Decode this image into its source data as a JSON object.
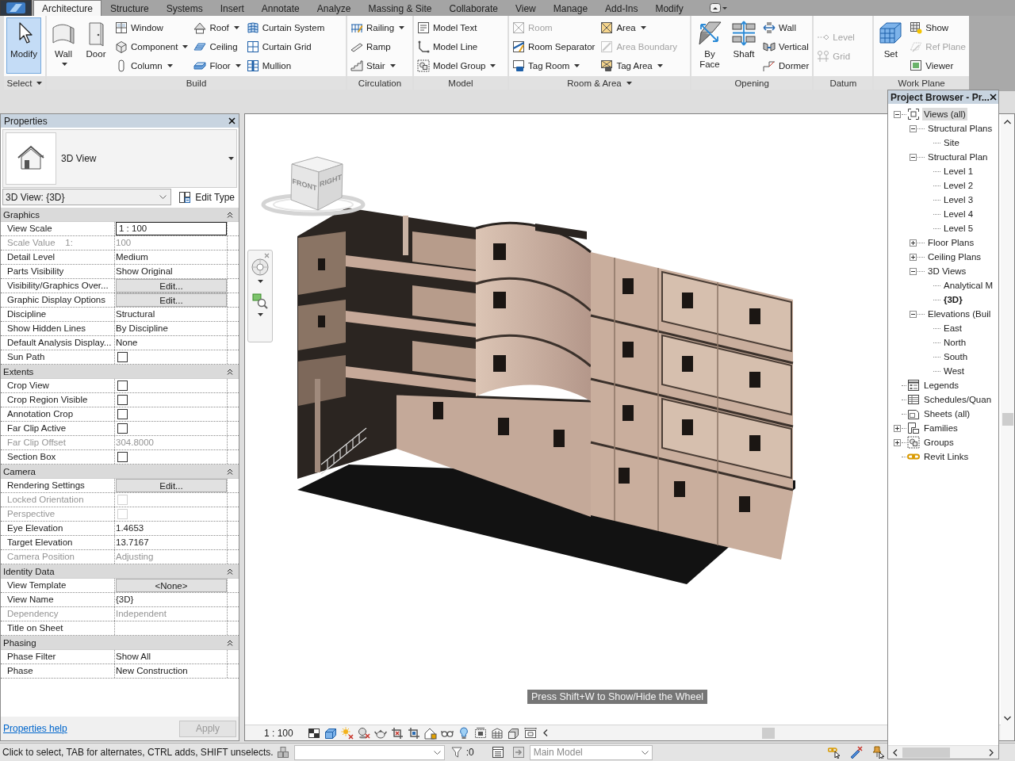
{
  "ribbon": {
    "tabs": [
      {
        "label": "Architecture",
        "selected": true
      },
      {
        "label": "Structure",
        "selected": false
      },
      {
        "label": "Systems",
        "selected": false
      },
      {
        "label": "Insert",
        "selected": false
      },
      {
        "label": "Annotate",
        "selected": false
      },
      {
        "label": "Analyze",
        "selected": false
      },
      {
        "label": "Massing & Site",
        "selected": false
      },
      {
        "label": "Collaborate",
        "selected": false
      },
      {
        "label": "View",
        "selected": false
      },
      {
        "label": "Manage",
        "selected": false
      },
      {
        "label": "Add-Ins",
        "selected": false
      },
      {
        "label": "Modify",
        "selected": false
      }
    ],
    "panels": [
      {
        "title": "Select",
        "title_dropdown": true,
        "columns": [
          {
            "kind": "large",
            "label": "Modify",
            "dropdown": false,
            "active": true
          }
        ]
      },
      {
        "title": "Build",
        "title_dropdown": false,
        "columns": [
          {
            "kind": "large",
            "label": "Wall",
            "dropdown": true,
            "active": false
          },
          {
            "kind": "large",
            "label": "Door",
            "dropdown": false,
            "active": false
          },
          {
            "kind": "stack",
            "items": [
              {
                "label": "Window",
                "dropdown": false,
                "disabled": false
              },
              {
                "label": "Component",
                "dropdown": true,
                "disabled": false
              },
              {
                "label": "Column",
                "dropdown": true,
                "disabled": false
              }
            ]
          },
          {
            "kind": "stack",
            "items": [
              {
                "label": "Roof",
                "dropdown": true,
                "disabled": false
              },
              {
                "label": "Ceiling",
                "dropdown": false,
                "disabled": false
              },
              {
                "label": "Floor",
                "dropdown": true,
                "disabled": false
              }
            ]
          },
          {
            "kind": "stack",
            "items": [
              {
                "label": "Curtain System",
                "dropdown": false,
                "disabled": false
              },
              {
                "label": "Curtain Grid",
                "dropdown": false,
                "disabled": false
              },
              {
                "label": "Mullion",
                "dropdown": false,
                "disabled": false
              }
            ]
          }
        ]
      },
      {
        "title": "Circulation",
        "title_dropdown": false,
        "columns": [
          {
            "kind": "stack",
            "items": [
              {
                "label": "Railing",
                "dropdown": true,
                "disabled": false
              },
              {
                "label": "Ramp",
                "dropdown": false,
                "disabled": false
              },
              {
                "label": "Stair",
                "dropdown": true,
                "disabled": false
              }
            ]
          }
        ]
      },
      {
        "title": "Model",
        "title_dropdown": false,
        "columns": [
          {
            "kind": "stack",
            "items": [
              {
                "label": "Model Text",
                "dropdown": false,
                "disabled": false
              },
              {
                "label": "Model Line",
                "dropdown": false,
                "disabled": false
              },
              {
                "label": "Model Group",
                "dropdown": true,
                "disabled": false
              }
            ]
          }
        ]
      },
      {
        "title": "Room & Area",
        "title_dropdown": true,
        "columns": [
          {
            "kind": "stack",
            "items": [
              {
                "label": "Room",
                "dropdown": false,
                "disabled": true
              },
              {
                "label": "Room Separator",
                "dropdown": false,
                "disabled": false
              },
              {
                "label": "Tag Room",
                "dropdown": true,
                "disabled": false
              }
            ]
          },
          {
            "kind": "stack",
            "items": [
              {
                "label": "Area",
                "dropdown": true,
                "disabled": false
              },
              {
                "label": "Area Boundary",
                "dropdown": false,
                "disabled": true
              },
              {
                "label": "Tag Area",
                "dropdown": true,
                "disabled": false
              }
            ]
          }
        ]
      },
      {
        "title": "Opening",
        "title_dropdown": false,
        "columns": [
          {
            "kind": "large",
            "label": "By Face",
            "dropdown": false,
            "active": false
          },
          {
            "kind": "large",
            "label": "Shaft",
            "dropdown": false,
            "active": false
          },
          {
            "kind": "stack",
            "items": [
              {
                "label": "Wall",
                "dropdown": false,
                "disabled": false
              },
              {
                "label": "Vertical",
                "dropdown": false,
                "disabled": false
              },
              {
                "label": "Dormer",
                "dropdown": false,
                "disabled": false
              }
            ]
          }
        ]
      },
      {
        "title": "Datum",
        "title_dropdown": false,
        "columns": [
          {
            "kind": "stack",
            "items": [
              {
                "label": "Level",
                "dropdown": false,
                "disabled": true
              },
              {
                "label": "Grid",
                "dropdown": false,
                "disabled": true
              }
            ]
          }
        ]
      },
      {
        "title": "Work Plane",
        "title_dropdown": false,
        "columns": [
          {
            "kind": "large",
            "label": "Set",
            "dropdown": false,
            "active": false
          },
          {
            "kind": "stack",
            "items": [
              {
                "label": "Show",
                "dropdown": false,
                "disabled": false
              },
              {
                "label": "Ref Plane",
                "dropdown": false,
                "disabled": true
              },
              {
                "label": "Viewer",
                "dropdown": false,
                "disabled": false
              }
            ]
          }
        ]
      }
    ]
  },
  "properties": {
    "title": "Properties",
    "type_name": "3D View",
    "instance": "3D View: {3D}",
    "edit_type": "Edit Type",
    "groups": [
      {
        "title": "Graphics",
        "expanded": true,
        "rows": [
          {
            "kind": "field",
            "label": "View Scale",
            "value": "1 : 100",
            "disabled": false
          },
          {
            "kind": "text",
            "label": "Scale Value    1:",
            "value": "100",
            "disabled": true
          },
          {
            "kind": "text",
            "label": "Detail Level",
            "value": "Medium",
            "disabled": false
          },
          {
            "kind": "text",
            "label": "Parts Visibility",
            "value": "Show Original",
            "disabled": false
          },
          {
            "kind": "button",
            "label": "Visibility/Graphics Over...",
            "value": "Edit...",
            "disabled": false
          },
          {
            "kind": "button",
            "label": "Graphic Display Options",
            "value": "Edit...",
            "disabled": false
          },
          {
            "kind": "text",
            "label": "Discipline",
            "value": "Structural",
            "disabled": false
          },
          {
            "kind": "text",
            "label": "Show Hidden Lines",
            "value": "By Discipline",
            "disabled": false
          },
          {
            "kind": "text",
            "label": "Default Analysis Display...",
            "value": "None",
            "disabled": false
          },
          {
            "kind": "checkbox",
            "label": "Sun Path",
            "checked": false,
            "disabled": false
          }
        ]
      },
      {
        "title": "Extents",
        "expanded": true,
        "rows": [
          {
            "kind": "checkbox",
            "label": "Crop View",
            "checked": false,
            "disabled": false
          },
          {
            "kind": "checkbox",
            "label": "Crop Region Visible",
            "checked": false,
            "disabled": false
          },
          {
            "kind": "checkbox",
            "label": "Annotation Crop",
            "checked": false,
            "disabled": false
          },
          {
            "kind": "checkbox",
            "label": "Far Clip Active",
            "checked": false,
            "disabled": false
          },
          {
            "kind": "text",
            "label": "Far Clip Offset",
            "value": "304.8000",
            "disabled": true
          },
          {
            "kind": "checkbox",
            "label": "Section Box",
            "checked": false,
            "disabled": false
          }
        ]
      },
      {
        "title": "Camera",
        "expanded": true,
        "rows": [
          {
            "kind": "button",
            "label": "Rendering Settings",
            "value": "Edit...",
            "disabled": false
          },
          {
            "kind": "checkbox",
            "label": "Locked Orientation",
            "checked": false,
            "disabled": true
          },
          {
            "kind": "checkbox",
            "label": "Perspective",
            "checked": false,
            "disabled": true
          },
          {
            "kind": "text",
            "label": "Eye Elevation",
            "value": "1.4653",
            "disabled": false
          },
          {
            "kind": "text",
            "label": "Target Elevation",
            "value": "13.7167",
            "disabled": false
          },
          {
            "kind": "text",
            "label": "Camera Position",
            "value": "Adjusting",
            "disabled": true
          }
        ]
      },
      {
        "title": "Identity Data",
        "expanded": true,
        "rows": [
          {
            "kind": "button",
            "label": "View Template",
            "value": "<None>",
            "disabled": false
          },
          {
            "kind": "text",
            "label": "View Name",
            "value": "{3D}",
            "disabled": false
          },
          {
            "kind": "text",
            "label": "Dependency",
            "value": "Independent",
            "disabled": true
          },
          {
            "kind": "text",
            "label": "Title on Sheet",
            "disabled": false
          }
        ]
      },
      {
        "title": "Phasing",
        "expanded": true,
        "rows": [
          {
            "kind": "text",
            "label": "Phase Filter",
            "value": "Show All",
            "disabled": false
          },
          {
            "kind": "text",
            "label": "Phase",
            "value": "New Construction",
            "disabled": false
          }
        ]
      }
    ],
    "help_link": "Properties help",
    "apply": {
      "label": "Apply",
      "disabled": true
    }
  },
  "view": {
    "view_cube": {
      "faces": [
        "FRONT",
        "RIGHT"
      ]
    },
    "tooltip": "Press Shift+W to Show/Hide the Wheel",
    "scale": "1 : 100"
  },
  "project_browser": {
    "title": "Project Browser - Pr...",
    "tree": [
      {
        "label": "Views (all)",
        "expanded": true,
        "selected": true,
        "current": false,
        "children": [
          {
            "label": "Structural Plans",
            "expanded": true,
            "selected": false,
            "current": false,
            "children": [
              {
                "label": "Site",
                "selected": false,
                "current": false
              }
            ]
          },
          {
            "label": "Structural Plan",
            "expanded": true,
            "selected": false,
            "current": false,
            "children": [
              {
                "label": "Level 1",
                "selected": false,
                "current": false
              },
              {
                "label": "Level 2",
                "selected": false,
                "current": false
              },
              {
                "label": "Level 3",
                "selected": false,
                "current": false
              },
              {
                "label": "Level 4",
                "selected": false,
                "current": false
              },
              {
                "label": "Level 5",
                "selected": false,
                "current": false
              }
            ]
          },
          {
            "label": "Floor Plans",
            "expanded": false,
            "selected": false,
            "current": false
          },
          {
            "label": "Ceiling Plans",
            "expanded": false,
            "selected": false,
            "current": false
          },
          {
            "label": "3D Views",
            "expanded": true,
            "selected": false,
            "current": false,
            "children": [
              {
                "label": "Analytical M",
                "selected": false,
                "current": false
              },
              {
                "label": "{3D}",
                "selected": false,
                "current": true
              }
            ]
          },
          {
            "label": "Elevations (Buil",
            "expanded": true,
            "selected": false,
            "current": false,
            "children": [
              {
                "label": "East",
                "selected": false,
                "current": false
              },
              {
                "label": "North",
                "selected": false,
                "current": false
              },
              {
                "label": "South",
                "selected": false,
                "current": false
              },
              {
                "label": "West",
                "selected": false,
                "current": false
              }
            ]
          }
        ]
      },
      {
        "label": "Legends",
        "selected": false,
        "current": false
      },
      {
        "label": "Schedules/Quan",
        "selected": false,
        "current": false
      },
      {
        "label": "Sheets (all)",
        "selected": false,
        "current": false
      },
      {
        "label": "Families",
        "expanded": false,
        "selected": false,
        "current": false
      },
      {
        "label": "Groups",
        "expanded": false,
        "selected": false,
        "current": false
      },
      {
        "label": "Revit Links",
        "selected": false,
        "current": false
      }
    ]
  },
  "status_bar": {
    "message": "Click to select, TAB for alternates, CTRL adds, SHIFT unselects.",
    "selection_count": ":0",
    "design_option": {
      "value": "Main Model",
      "disabled": true
    }
  }
}
